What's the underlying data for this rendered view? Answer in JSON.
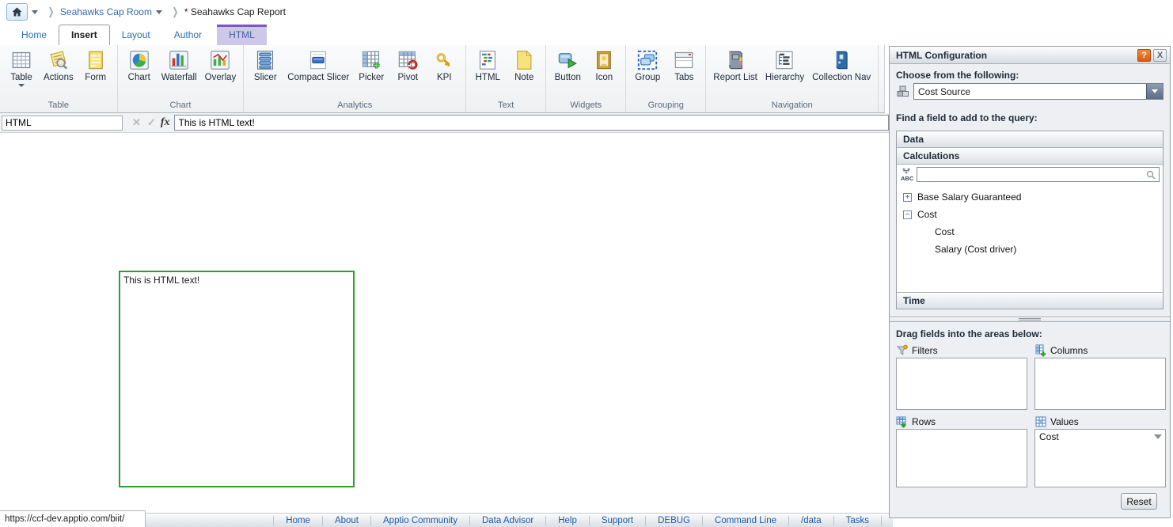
{
  "breadcrumb": {
    "room": "Seahawks Cap Room",
    "report": "* Seahawks Cap Report"
  },
  "tabs": {
    "items": [
      {
        "label": "Home"
      },
      {
        "label": "Insert",
        "selected": true
      },
      {
        "label": "Layout"
      },
      {
        "label": "Author"
      },
      {
        "label": "HTML",
        "contextual": true
      }
    ]
  },
  "ribbon": {
    "groups": [
      {
        "label": "Table",
        "buttons": [
          {
            "label": "Table",
            "has_dropdown": true
          },
          {
            "label": "Actions"
          },
          {
            "label": "Form"
          }
        ]
      },
      {
        "label": "Chart",
        "buttons": [
          {
            "label": "Chart"
          },
          {
            "label": "Waterfall"
          },
          {
            "label": "Overlay"
          }
        ]
      },
      {
        "label": "Analytics",
        "buttons": [
          {
            "label": "Slicer"
          },
          {
            "label": "Compact Slicer"
          },
          {
            "label": "Picker"
          },
          {
            "label": "Pivot"
          },
          {
            "label": "KPI"
          }
        ]
      },
      {
        "label": "Text",
        "buttons": [
          {
            "label": "HTML"
          },
          {
            "label": "Note"
          }
        ]
      },
      {
        "label": "Widgets",
        "buttons": [
          {
            "label": "Button"
          },
          {
            "label": "Icon"
          }
        ]
      },
      {
        "label": "Grouping",
        "buttons": [
          {
            "label": "Group"
          },
          {
            "label": "Tabs"
          }
        ]
      },
      {
        "label": "Navigation",
        "buttons": [
          {
            "label": "Report List"
          },
          {
            "label": "Hierarchy"
          },
          {
            "label": "Collection Nav"
          }
        ]
      }
    ]
  },
  "formula_bar": {
    "name_box": "HTML",
    "cancel_glyph": "✕",
    "accept_glyph": "✓",
    "fx_label": "fx",
    "formula": "This is HTML text!"
  },
  "canvas": {
    "widget_text": "This is HTML text!",
    "widget_border_color": "#2f9e2f"
  },
  "panel": {
    "title": "HTML Configuration",
    "help_label": "?",
    "close_label": "X",
    "choose_label": "Choose from the following:",
    "source_value": "Cost Source",
    "find_label": "Find a field to add to the query:",
    "sections": {
      "data": "Data",
      "calculations": "Calculations",
      "time": "Time"
    },
    "search_value": "",
    "tree": [
      {
        "label": "Base Salary Guaranteed",
        "glyph": "+"
      },
      {
        "label": "Cost",
        "glyph": "−"
      },
      {
        "label": "Cost"
      },
      {
        "label": "Salary (Cost driver)"
      }
    ],
    "drag_label": "Drag fields into the areas below:",
    "areas": {
      "filters": "Filters",
      "columns": "Columns",
      "rows": "Rows",
      "values": "Values"
    },
    "values_selected": "Cost",
    "reset_label": "Reset"
  },
  "status_bar": {
    "url_tooltip": "https://ccf-dev.apptio.com/biit/",
    "links": [
      "Home",
      "About",
      "Apptio Community",
      "Data Advisor",
      "Help",
      "Support",
      "DEBUG",
      "Command Line",
      "/data",
      "Tasks"
    ]
  },
  "colors": {
    "link_blue": "#2e6db4",
    "contextual_purple": "#7b57c8",
    "contextual_bg": "#cdc7ea",
    "widget_green": "#2f9e2f",
    "help_orange": "#dd5a12"
  }
}
